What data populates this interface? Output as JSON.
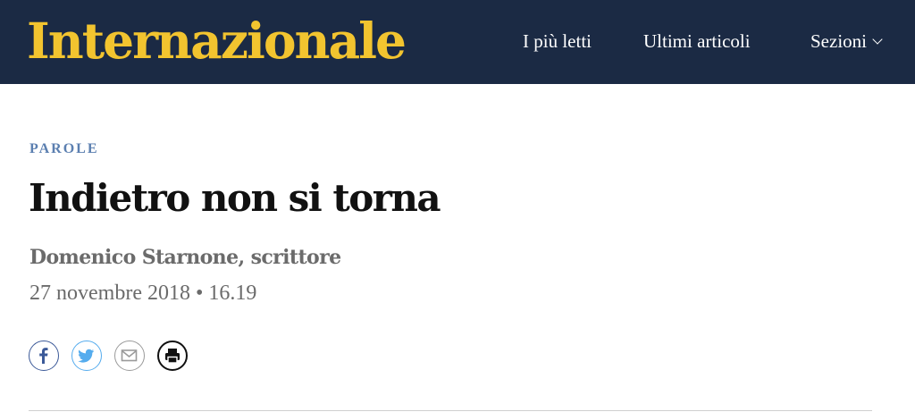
{
  "header": {
    "logo": "Internazionale",
    "nav": {
      "most_read": "I più letti",
      "latest": "Ultimi articoli",
      "sections": "Sezioni"
    }
  },
  "article": {
    "category": "PAROLE",
    "title": "Indietro non si torna",
    "author": "Domenico Starnone, scrittore",
    "date": "27 novembre 2018 • 16.19"
  },
  "share": {
    "icons": [
      "facebook-icon",
      "twitter-icon",
      "mail-icon",
      "print-icon"
    ]
  },
  "colors": {
    "header_background": "#1b2a44",
    "logo": "#f2c42f",
    "category": "#5b7fb0",
    "title": "#111111",
    "meta": "#6b6b6b"
  }
}
